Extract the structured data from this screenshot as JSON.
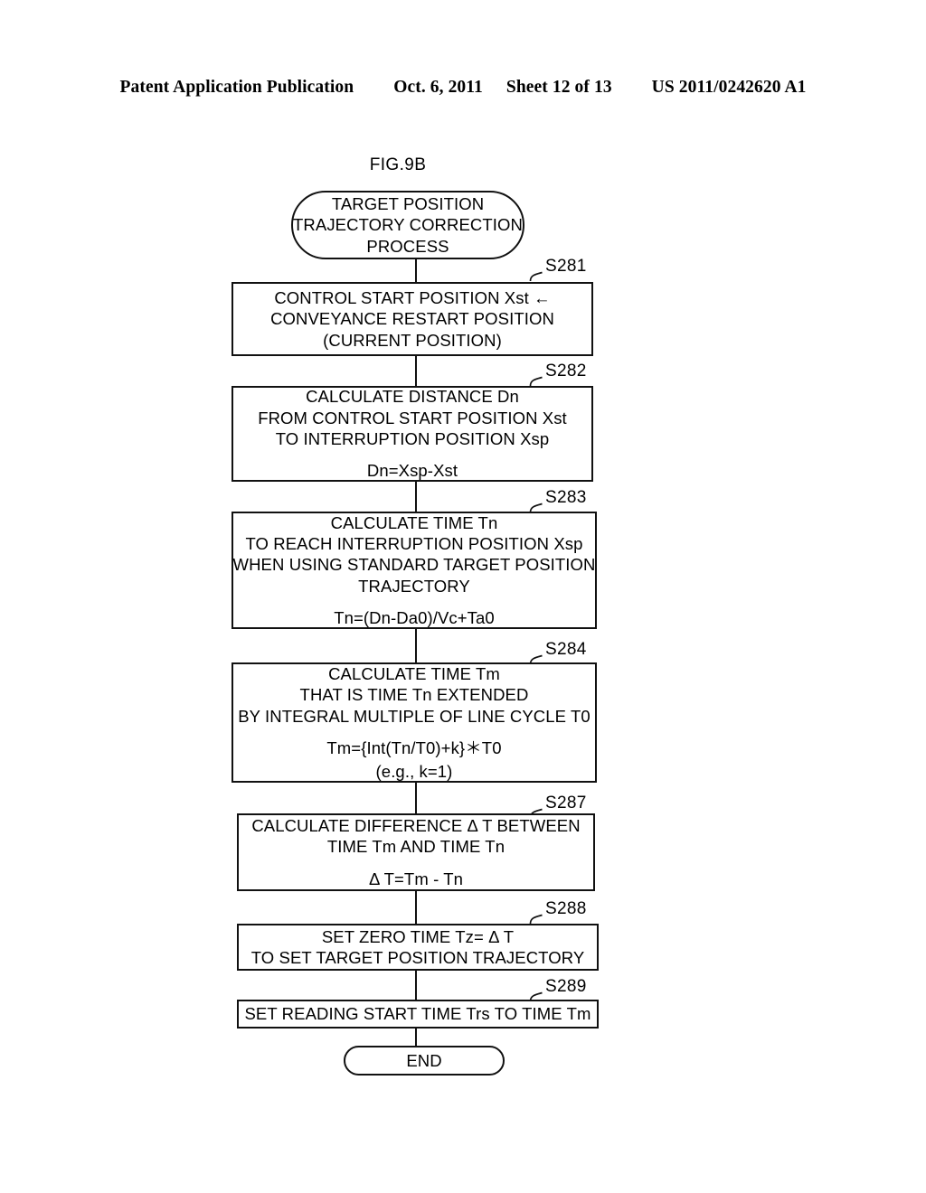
{
  "header": {
    "publication": "Patent Application Publication",
    "date": "Oct. 6, 2011",
    "sheet": "Sheet 12 of 13",
    "patent_number": "US 2011/0242620 A1"
  },
  "figure": {
    "title": "FIG.9B"
  },
  "flowchart": {
    "start": {
      "line1": "TARGET POSITION",
      "line2": "TRAJECTORY CORRECTION",
      "line3": "PROCESS"
    },
    "steps": [
      {
        "id": "S281",
        "label": "S281",
        "line1": "CONTROL START POSITION Xst ←",
        "line2": "CONVEYANCE RESTART POSITION",
        "line3": "(CURRENT POSITION)"
      },
      {
        "id": "S282",
        "label": "S282",
        "line1": "CALCULATE DISTANCE Dn",
        "line2": "FROM CONTROL START POSITION Xst",
        "line3": "TO INTERRUPTION POSITION Xsp",
        "formula": "Dn=Xsp-Xst"
      },
      {
        "id": "S283",
        "label": "S283",
        "line1": "CALCULATE TIME Tn",
        "line2": "TO REACH INTERRUPTION POSITION Xsp",
        "line3": "WHEN USING STANDARD TARGET POSITION",
        "line4": "TRAJECTORY",
        "formula": "Tn=(Dn-Da0)/Vc+Ta0"
      },
      {
        "id": "S284",
        "label": "S284",
        "line1": "CALCULATE TIME Tm",
        "line2": "THAT IS TIME Tn EXTENDED",
        "line3": "BY INTEGRAL MULTIPLE OF LINE CYCLE T0",
        "formula": "Tm={Int(Tn/T0)+k}＊T0",
        "sub": "(e.g., k=1)"
      },
      {
        "id": "S287",
        "label": "S287",
        "line1": "CALCULATE DIFFERENCE Δ T BETWEEN",
        "line2": "TIME Tm AND TIME Tn",
        "formula": "Δ T=Tm - Tn"
      },
      {
        "id": "S288",
        "label": "S288",
        "line1": "SET ZERO TIME Tz= Δ T",
        "line2": "TO SET TARGET POSITION TRAJECTORY"
      },
      {
        "id": "S289",
        "label": "S289",
        "line1": "SET READING START TIME Trs TO TIME Tm"
      }
    ],
    "end": {
      "label": "END"
    }
  },
  "colors": {
    "ink": "#111111",
    "paper": "#ffffff"
  }
}
